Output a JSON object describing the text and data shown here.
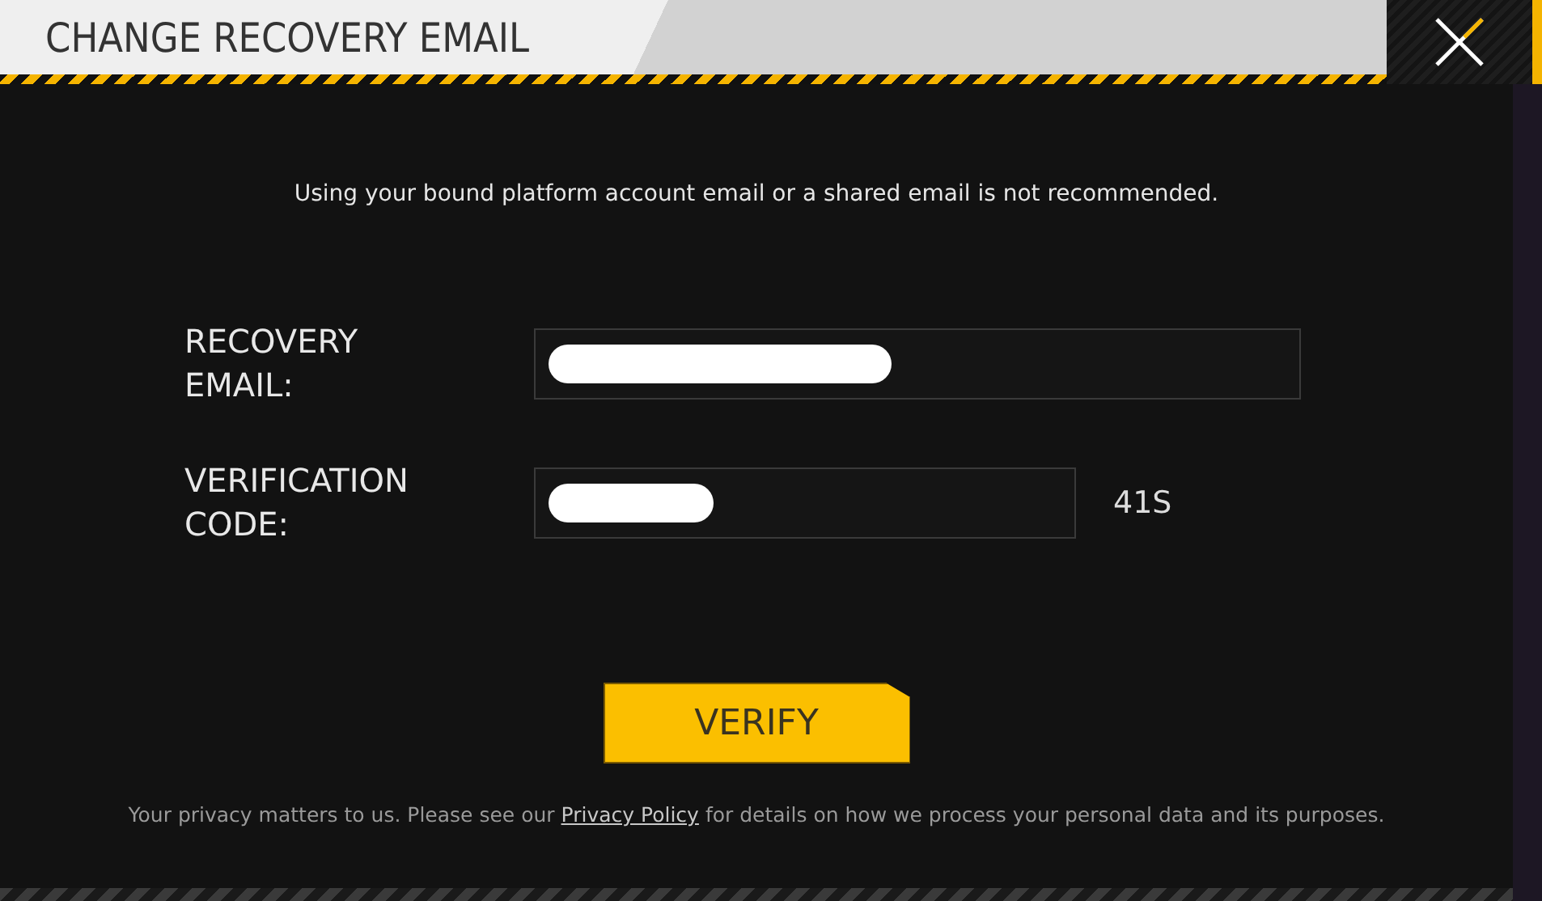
{
  "dialog": {
    "title": "CHANGE RECOVERY EMAIL"
  },
  "notice": "Using your bound platform account email or a shared email is not recommended.",
  "fields": [
    {
      "label": "RECOVERY EMAIL:",
      "redacted": true
    },
    {
      "label": "VERIFICATION CODE:",
      "redacted": true,
      "timer": "41S"
    }
  ],
  "verify_button": "VERIFY",
  "privacy": {
    "before": "Your privacy matters to us. Please see our",
    "link": "Privacy Policy",
    "after": "for details on how we process your personal data and its purposes."
  }
}
